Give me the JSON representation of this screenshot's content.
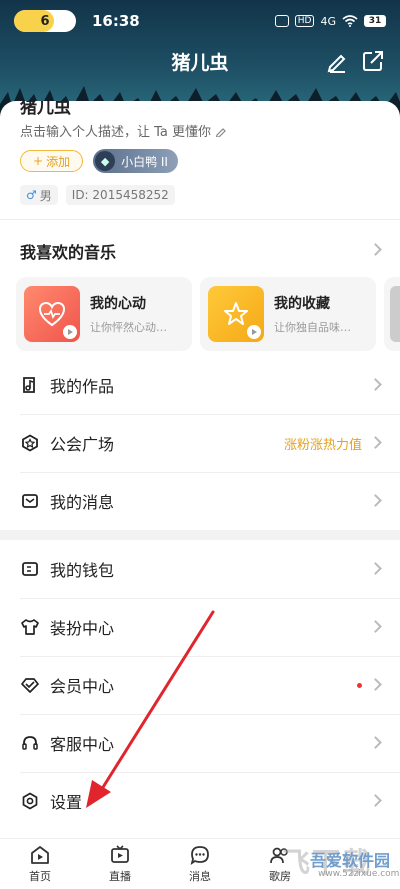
{
  "status_bar": {
    "battery_level": "6",
    "time": "16:38",
    "hd": "HD",
    "signal": "4G",
    "battery_pct": "31"
  },
  "header": {
    "title": "猪儿虫"
  },
  "profile": {
    "name_cut": "猪儿虫",
    "description": "点击输入个人描述，让 Ta 更懂你",
    "add_label": "添加",
    "level_label": "小白鸭 II",
    "gender": "男",
    "user_id": "ID: 2015458252"
  },
  "music": {
    "title": "我喜欢的音乐",
    "cards": [
      {
        "title": "我的心动",
        "subtitle": "让你怦然心动…",
        "color": "#f26b5b"
      },
      {
        "title": "我的收藏",
        "subtitle": "让你独自品味…",
        "color": "#f6b820"
      }
    ]
  },
  "menu": [
    {
      "label": "我的作品",
      "icon": "music-note-icon"
    },
    {
      "label": "公会广场",
      "icon": "guild-icon",
      "extra": "涨粉涨热力值"
    },
    {
      "label": "我的消息",
      "icon": "mail-icon"
    },
    {
      "label": "我的钱包",
      "icon": "wallet-icon"
    },
    {
      "label": "装扮中心",
      "icon": "tshirt-icon"
    },
    {
      "label": "会员中心",
      "icon": "vip-icon"
    },
    {
      "label": "客服中心",
      "icon": "headset-icon"
    },
    {
      "label": "设置",
      "icon": "settings-icon"
    }
  ],
  "bottom_nav": [
    {
      "label": "首页"
    },
    {
      "label": "直播"
    },
    {
      "label": "消息"
    },
    {
      "label": "歌房"
    }
  ],
  "watermark": {
    "big": "飞下载",
    "brand": "吾爱软件园",
    "url": "www.52zixue.com"
  },
  "colors": {
    "accent": "#e4a21f",
    "red_dot": "#e33333",
    "arrow": "#e0262c"
  }
}
